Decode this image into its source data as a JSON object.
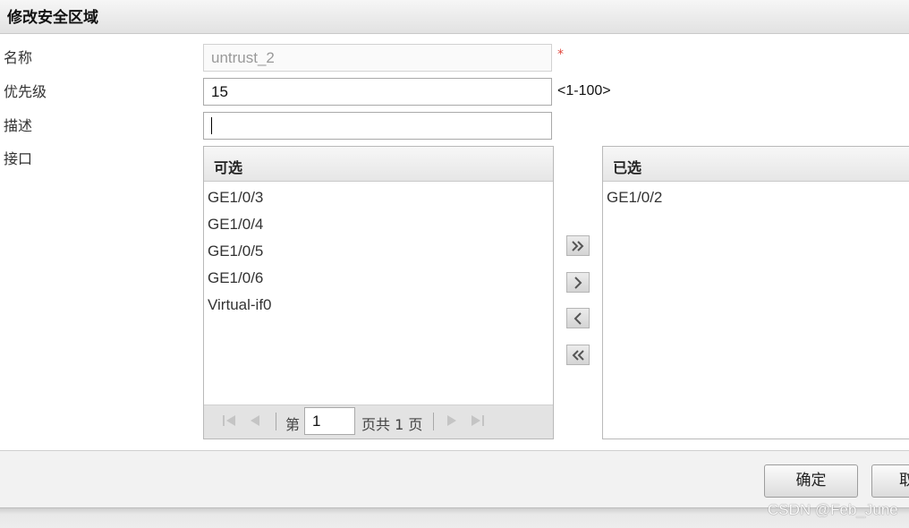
{
  "dialog": {
    "title": "修改安全区域"
  },
  "form": {
    "name_label": "名称",
    "name_value": "untrust_2",
    "required_mark": "*",
    "priority_label": "优先级",
    "priority_value": "15",
    "priority_hint": "<1-100>",
    "desc_label": "描述",
    "desc_value": "",
    "interface_label": "接口"
  },
  "available": {
    "header": "可选",
    "items": [
      "GE1/0/3",
      "GE1/0/4",
      "GE1/0/5",
      "GE1/0/6",
      "Virtual-if0"
    ]
  },
  "pager": {
    "page_prefix": "第",
    "page_value": "1",
    "page_suffix": "页共 1 页"
  },
  "selected": {
    "header": "已选",
    "items": [
      "GE1/0/2"
    ]
  },
  "move_buttons": [
    {
      "name": "add-all",
      "icon": "double-chevron-right-icon"
    },
    {
      "name": "add",
      "icon": "chevron-right-icon"
    },
    {
      "name": "remove",
      "icon": "chevron-left-icon"
    },
    {
      "name": "remove-all",
      "icon": "double-chevron-left-icon"
    }
  ],
  "footer": {
    "ok_label": "确定",
    "cancel_label": "取"
  },
  "watermark": "CSDN @Feb_June"
}
